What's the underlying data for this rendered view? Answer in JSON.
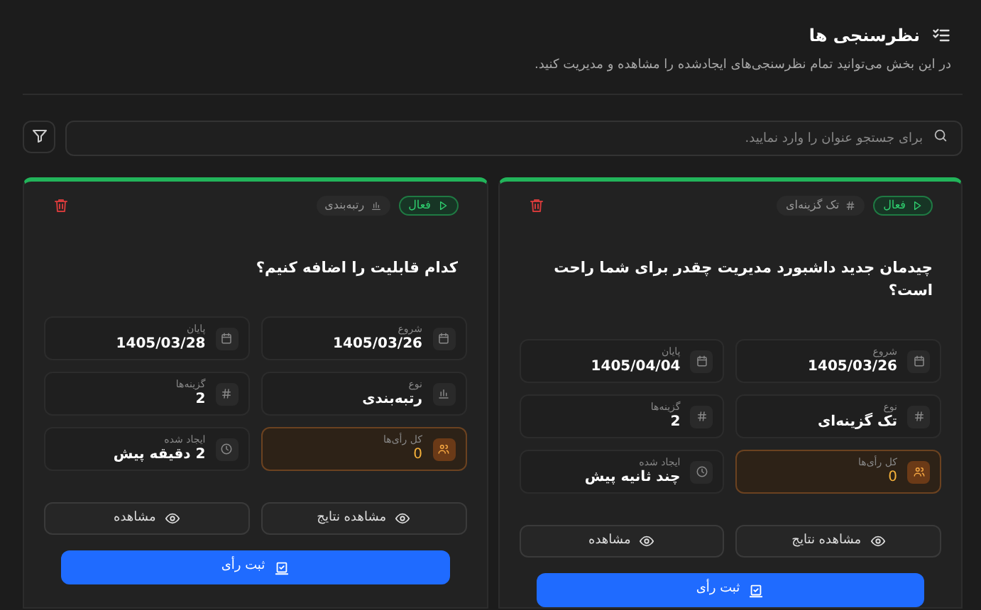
{
  "header": {
    "title": "نظرسنجی ها",
    "description": "در این بخش می‌توانید تمام نظرسنجی‌های ایجادشده را مشاهده و مدیریت کنید."
  },
  "search": {
    "placeholder": "برای جستجو عنوان را وارد نمایید."
  },
  "polls": [
    {
      "status": {
        "label": "فعال",
        "kind": "active"
      },
      "type_badge": {
        "label": "تک گزینه‌ای",
        "kind": "hash"
      },
      "title": "چیدمان جدید داشبورد مدیریت چقدر برای شما راحت است؟",
      "stats": [
        {
          "label": "شروع",
          "value": "1405/03/26",
          "kind": "calendar",
          "highlighted": false
        },
        {
          "label": "پایان",
          "value": "1405/04/04",
          "kind": "calendar",
          "highlighted": false
        },
        {
          "label": "نوع",
          "value": "تک گزینه‌ای",
          "kind": "hash",
          "highlighted": false
        },
        {
          "label": "گزینه‌ها",
          "value": "2",
          "kind": "hash",
          "highlighted": false
        },
        {
          "label": "کل رأی‌ها",
          "value": "0",
          "kind": "users",
          "highlighted": true
        },
        {
          "label": "ایجاد شده",
          "value": "چند ثانیه پیش",
          "kind": "clock",
          "highlighted": false
        }
      ],
      "buttons": [
        {
          "label": "مشاهده نتایج"
        },
        {
          "label": "مشاهده"
        }
      ],
      "vote_button": "ثبت رأی"
    },
    {
      "status": {
        "label": "فعال",
        "kind": "active"
      },
      "type_badge": {
        "label": "رتبه‌بندی",
        "kind": "chart"
      },
      "title": "کدام قابلیت را اضافه کنیم؟",
      "stats": [
        {
          "label": "شروع",
          "value": "1405/03/26",
          "kind": "calendar",
          "highlighted": false
        },
        {
          "label": "پایان",
          "value": "1405/03/28",
          "kind": "calendar",
          "highlighted": false
        },
        {
          "label": "نوع",
          "value": "رتبه‌بندی",
          "kind": "chart",
          "highlighted": false
        },
        {
          "label": "گزینه‌ها",
          "value": "2",
          "kind": "hash",
          "highlighted": false
        },
        {
          "label": "کل رأی‌ها",
          "value": "0",
          "kind": "users",
          "highlighted": true
        },
        {
          "label": "ایجاد شده",
          "value": "2 دقیقه پیش",
          "kind": "clock",
          "highlighted": false
        }
      ],
      "buttons": [
        {
          "label": "مشاهده نتایج"
        },
        {
          "label": "مشاهده"
        }
      ],
      "vote_button": "ثبت رأی"
    }
  ]
}
